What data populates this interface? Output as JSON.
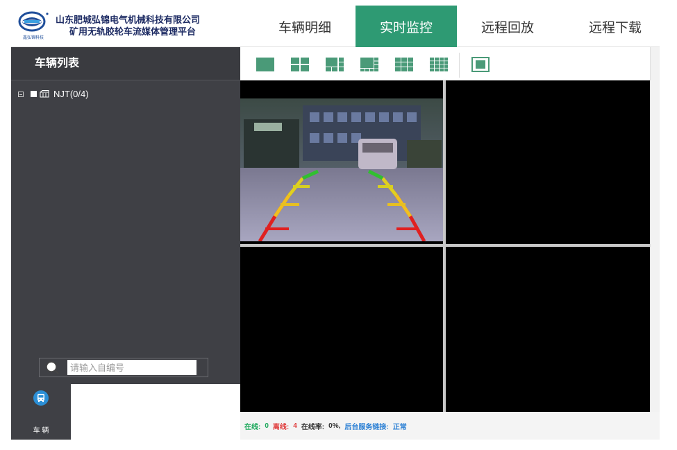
{
  "header": {
    "logo_text": "鑫弘锦科技",
    "company_line1": "山东肥城弘锦电气机械科技有限公司",
    "company_line2": "矿用无轨胶轮车流媒体管理平台",
    "nav": [
      {
        "label": "车辆明细",
        "active": false
      },
      {
        "label": "实时监控",
        "active": true
      },
      {
        "label": "远程回放",
        "active": false
      },
      {
        "label": "远程下载",
        "active": false
      }
    ]
  },
  "sidebar": {
    "title": "车辆列表",
    "tree": [
      {
        "label": "NJT(0/4)"
      }
    ],
    "search": {
      "placeholder": "请输入自编号",
      "value": ""
    }
  },
  "bottom_nav": {
    "items": [
      {
        "label": "车 辆",
        "icon": "bus-icon"
      }
    ]
  },
  "toolbar": {
    "layouts": [
      "layout-1-icon",
      "layout-4-icon",
      "layout-6-icon",
      "layout-8-icon",
      "layout-9-icon",
      "layout-16-icon",
      "fullscreen-icon"
    ]
  },
  "status": {
    "online_label": "在线:",
    "online_value": "0",
    "offline_label": "离线:",
    "offline_value": "4",
    "rate_label": "在线率:",
    "rate_value": "0%,",
    "service_label": "后台服务链接:",
    "service_value": "正常"
  },
  "colors": {
    "accent": "#2e9a73",
    "sidebar_bg": "#3f4045",
    "online": "#1aa85a",
    "offline": "#e03c3c",
    "link": "#2a7fd4"
  }
}
